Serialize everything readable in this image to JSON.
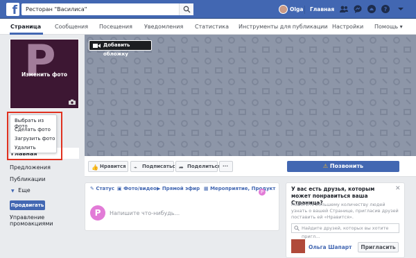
{
  "topbar": {
    "logo_letter": "f",
    "search_value": "Ресторан \"Василиса\"",
    "user_name": "Olga",
    "home_label": "Главная",
    "brand_color": "#4267b2"
  },
  "subnav": {
    "tabs": [
      {
        "label": "Страница",
        "active": true
      },
      {
        "label": "Сообщения"
      },
      {
        "label": "Посещения"
      },
      {
        "label": "Уведомления"
      },
      {
        "label": "Статистика"
      },
      {
        "label": "Инструменты для публикации"
      },
      {
        "label": "Настройки"
      },
      {
        "label": "Помощь ▾"
      }
    ]
  },
  "profile": {
    "letter": "P",
    "change_photo_label": "Изменить фото"
  },
  "photo_menu": {
    "items": [
      "Выбрать из фото",
      "Сделать фото",
      "Загрузить фото",
      "Удалить"
    ]
  },
  "left_nav": {
    "active": "Главная",
    "items": [
      "Предложения",
      "Публикации",
      "Еще"
    ],
    "promote_button": "Продвигать",
    "manage_promotions": "Управление промоакциями"
  },
  "cover": {
    "add_cover_label": "Добавить обложку"
  },
  "actions": {
    "like": "Нравится",
    "follow": "Подписаться",
    "share": "Поделиться",
    "more": "···",
    "call": "Позвонить",
    "call_icon": "warning-icon"
  },
  "composer": {
    "tabs": [
      "Статус",
      "Фото/видео",
      "Прямой эфир",
      "Мероприятие, Продукт"
    ],
    "avatar_letter": "P",
    "placeholder": "Напишите что-нибудь..."
  },
  "invite_card": {
    "title": "У вас есть друзья, которым может понравиться ваша Страница?",
    "text": "Помогите большему количеству людей узнать о вашей Странице, пригласив друзей поставить ей «Нравится».",
    "search_placeholder": "Найдите друзей, которых вы хотите пригл...",
    "friend_name": "Ольга Шапарт",
    "invite_button": "Пригласить"
  }
}
